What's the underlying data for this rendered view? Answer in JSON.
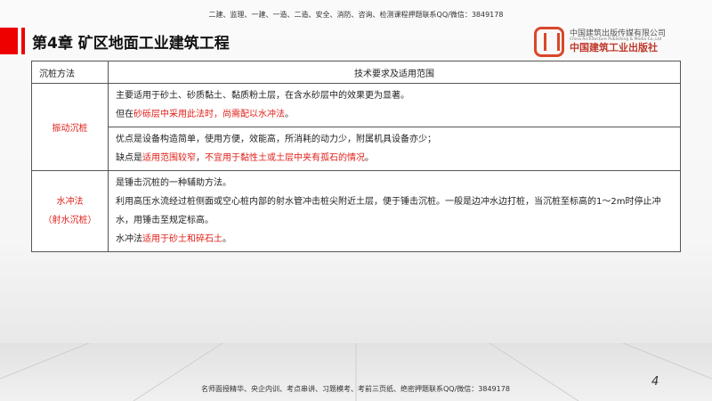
{
  "top_note": "二建、监理、一建、一造、二造、安全、消防、咨询、检测课程押题联系QQ/微信：3849178",
  "title": "第4章 矿区地面工业建筑工程",
  "logo": {
    "cn": "中国建筑出版传媒有限公司",
    "en": "China Architecture Publishing & Media Co.,Ltd",
    "big": "中国建筑工业出版社"
  },
  "table": {
    "headers": [
      "沉桩方法",
      "技术要求及适用范围"
    ],
    "rows": [
      {
        "method": "振动沉桩",
        "l1": "主要适用于砂土、砂质黏土、黏质粉土层，在含水砂层中的效果更为显著。",
        "l2a": "但在",
        "l2b": "砂砾层中采用此法时，尚需配以水冲法",
        "l2c": "。",
        "l3": "优点是设备构造简单，使用方便，效能高，所消耗的动力少，附属机具设备亦少；",
        "l4a": "缺点是",
        "l4b": "适用范围较窄",
        "l4c": "，",
        "l4d": "不宜用于黏性土或土层中夹有孤石的情况",
        "l4e": "。"
      },
      {
        "method": "水冲法",
        "method2": "（射水沉桩）",
        "l1": "是锤击沉桩的一种辅助方法。",
        "l2": "利用高压水流经过桩侧面或空心桩内部的射水管冲击桩尖附近土层，便于锤击沉桩。一般是边冲水边打桩，当沉桩至标高的1～2m时停止冲水，用锤击至规定标高。",
        "l3a": "水冲法",
        "l3b": "适用于砂土和碎石土",
        "l3c": "。"
      }
    ]
  },
  "page_number": "4",
  "footer": "名师面授精华、央企内训、考点串讲、习题模考、考前三页纸、绝密押题联系QQ/微信：3849178"
}
